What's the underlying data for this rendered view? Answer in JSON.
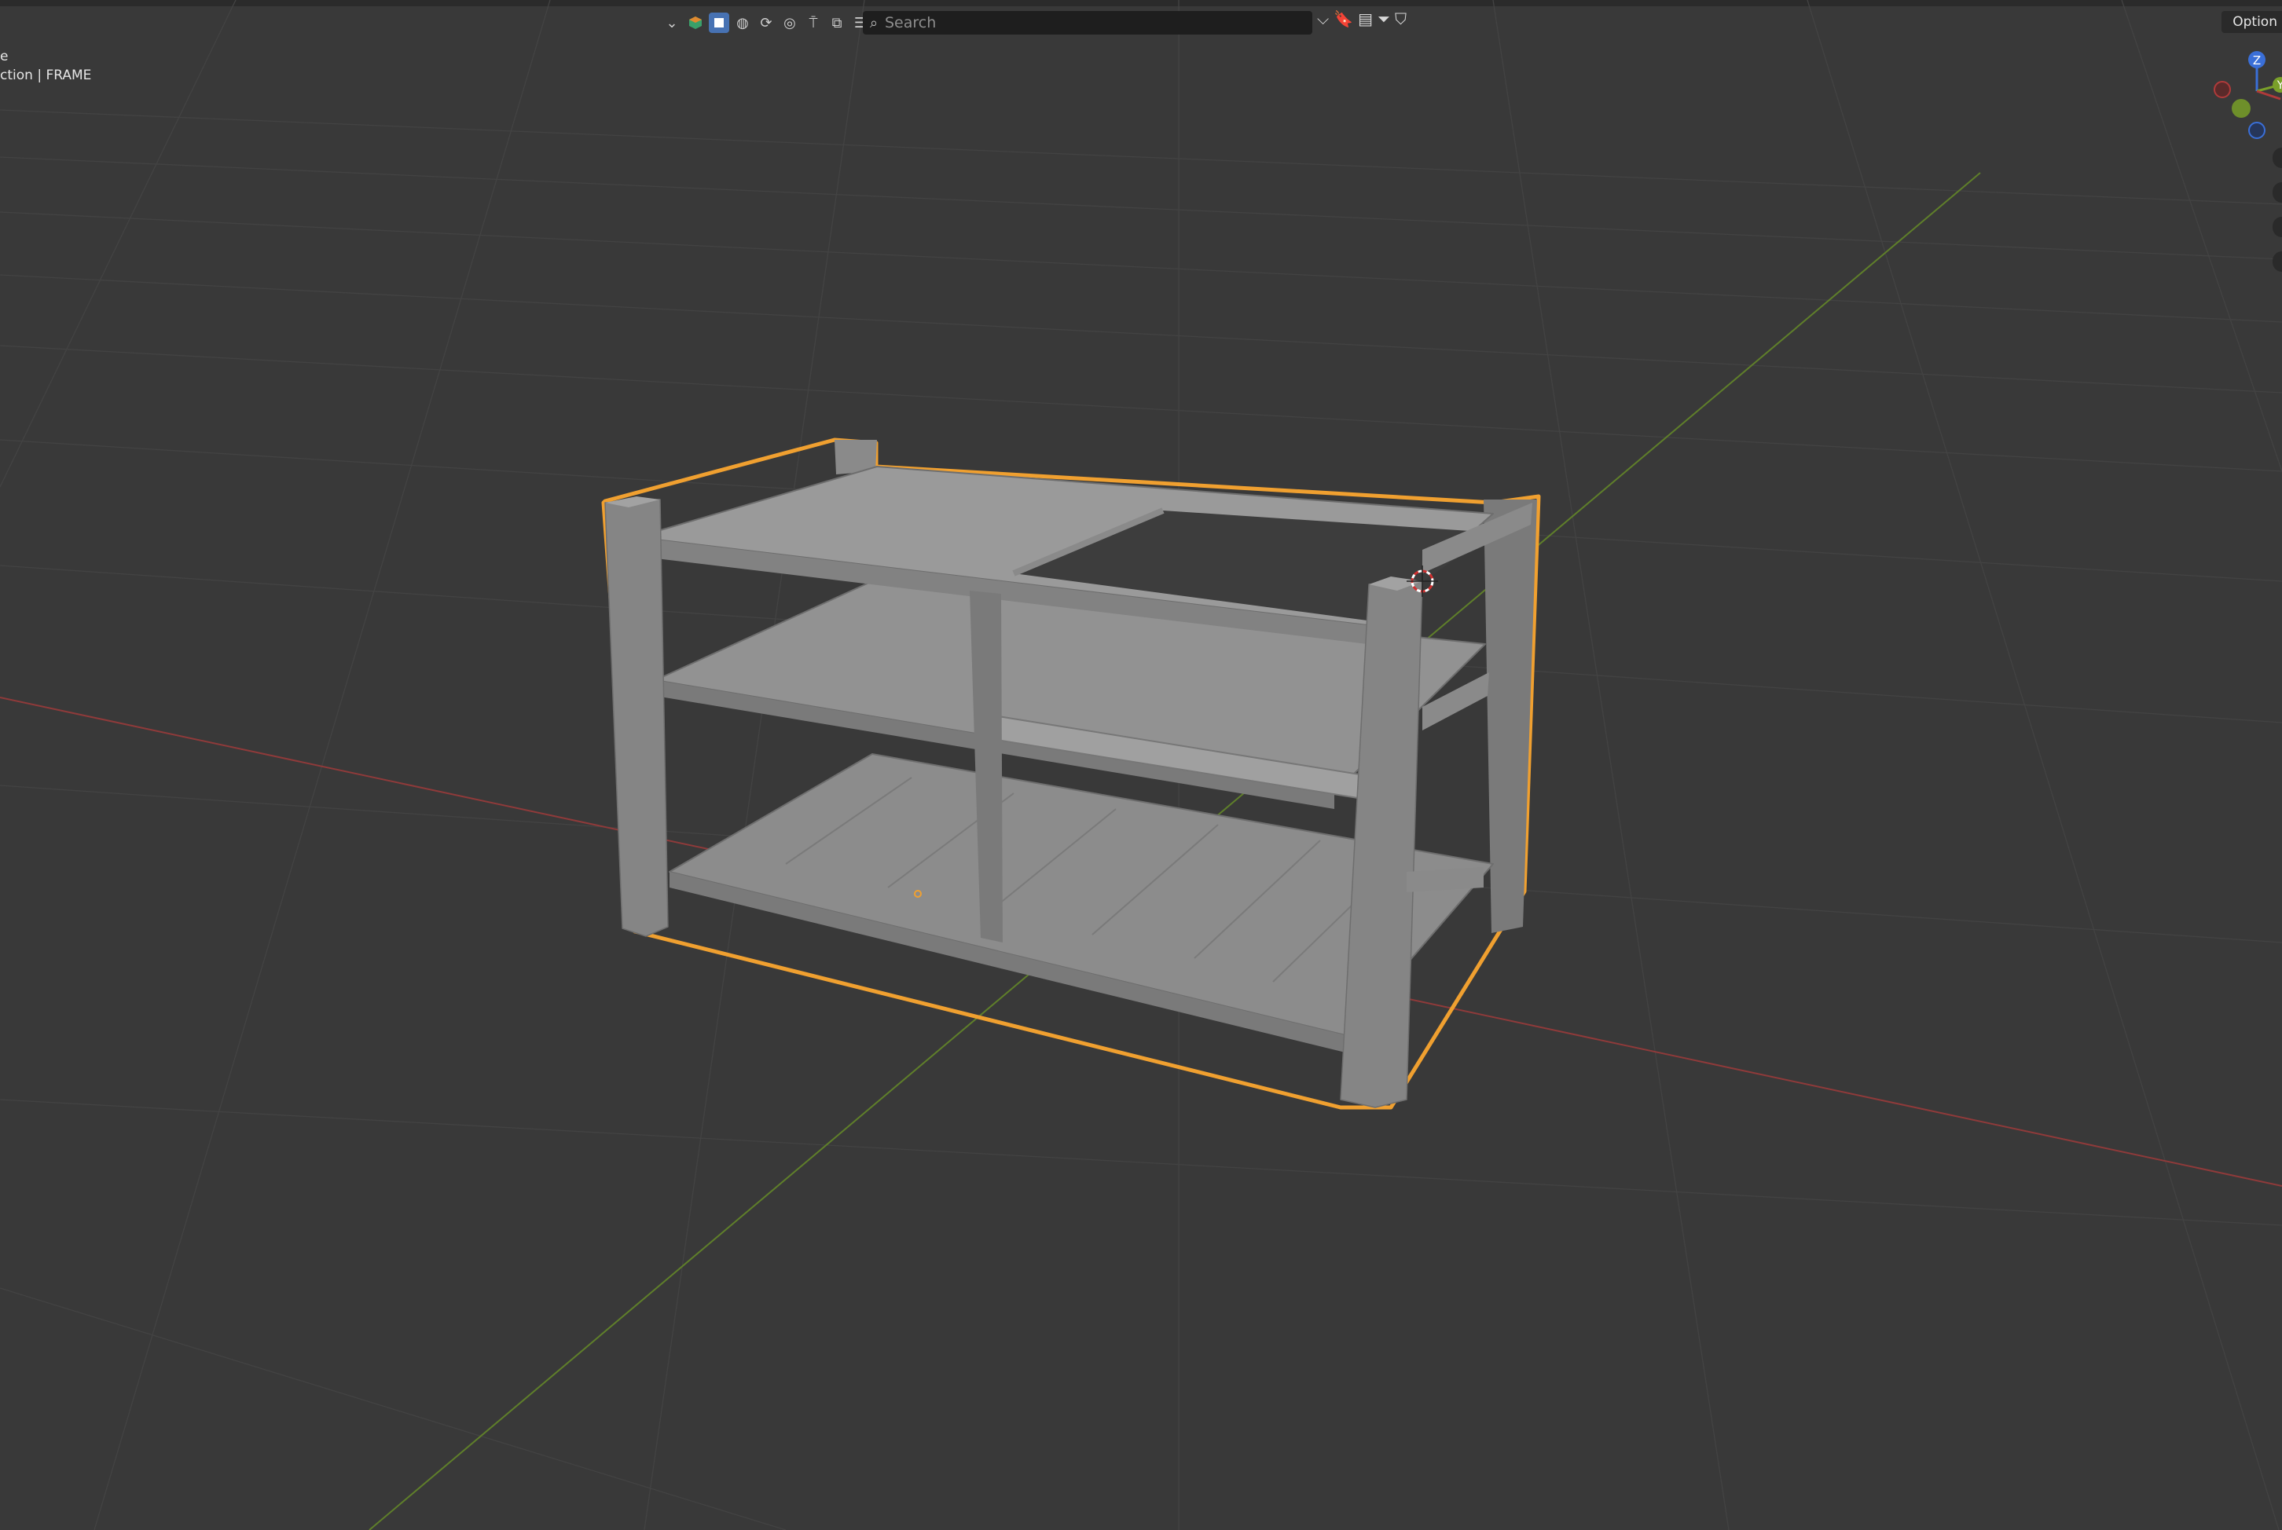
{
  "header": {
    "search_placeholder": "Search",
    "options_label": "Option"
  },
  "viewport_info": {
    "line1": "e",
    "line2": "ction | FRAME"
  },
  "gizmo": {
    "z_label": "Z",
    "y_label": "Y"
  },
  "icons": [
    "dropdown-icon",
    "object-mode-icon",
    "select-box-icon",
    "view-icon",
    "transform-icon",
    "snap-icon",
    "proportional-icon",
    "overlay-icon",
    "gizmo-icon",
    "search-icon",
    "bookmark-icon",
    "layout-icon",
    "filter-icon",
    "shield-icon"
  ],
  "colors": {
    "background": "#393939",
    "selection_outline": "#f0a030",
    "x_axis": "#a23a3a",
    "y_axis": "#6b8f2a",
    "z_axis": "#3a6fd8"
  }
}
